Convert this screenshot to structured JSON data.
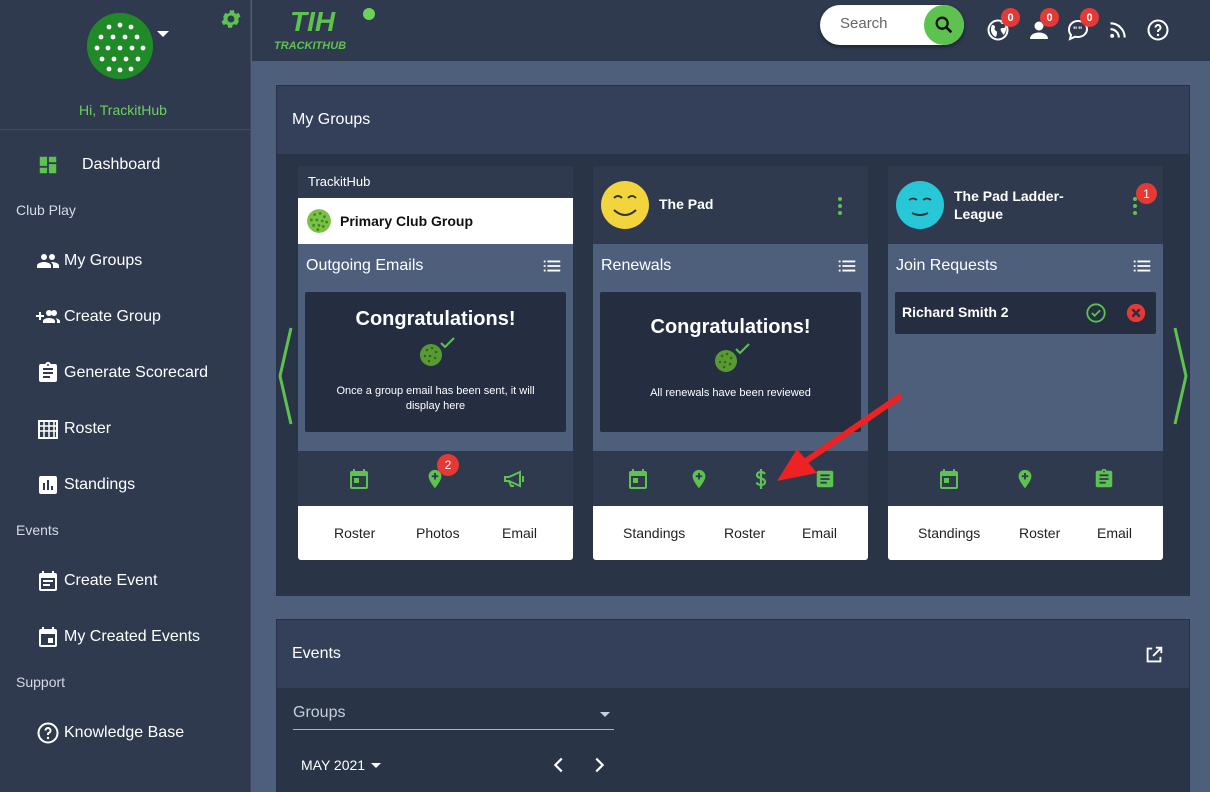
{
  "sidebar": {
    "greeting": "Hi, TrackitHub",
    "dashboard": "Dashboard",
    "section_club": "Club Play",
    "my_groups": "My Groups",
    "create_group": "Create Group",
    "generate_scorecard": "Generate Scorecard",
    "roster": "Roster",
    "standings": "Standings",
    "section_events": "Events",
    "create_event": "Create Event",
    "my_created_events": "My Created Events",
    "section_support": "Support",
    "knowledge_base": "Knowledge Base"
  },
  "topbar": {
    "logo_text": "TRACKITHUB",
    "search_placeholder": "Search",
    "globe_count": "0",
    "user_count": "0",
    "chat_count": "0"
  },
  "groups": {
    "title": "My Groups",
    "card1": {
      "org": "TrackitHub",
      "name": "Primary Club Group",
      "section": "Outgoing Emails",
      "congrats": "Congratulations!",
      "message": "Once a group email has been sent, it will display here",
      "photos_badge": "2",
      "links": [
        "Roster",
        "Photos",
        "Email"
      ]
    },
    "card2": {
      "name": "The Pad",
      "section": "Renewals",
      "congrats": "Congratulations!",
      "message": "All renewals have been reviewed",
      "links": [
        "Standings",
        "Roster",
        "Email"
      ]
    },
    "card3": {
      "name": "The Pad Ladder-League",
      "badge": "1",
      "section": "Join Requests",
      "request_name": "Richard Smith 2",
      "links": [
        "Standings",
        "Roster",
        "Email"
      ]
    }
  },
  "events": {
    "title": "Events",
    "groups_label": "Groups",
    "month": "MAY 2021"
  },
  "colors": {
    "accent": "#5ec24f",
    "badge": "#e53935"
  }
}
